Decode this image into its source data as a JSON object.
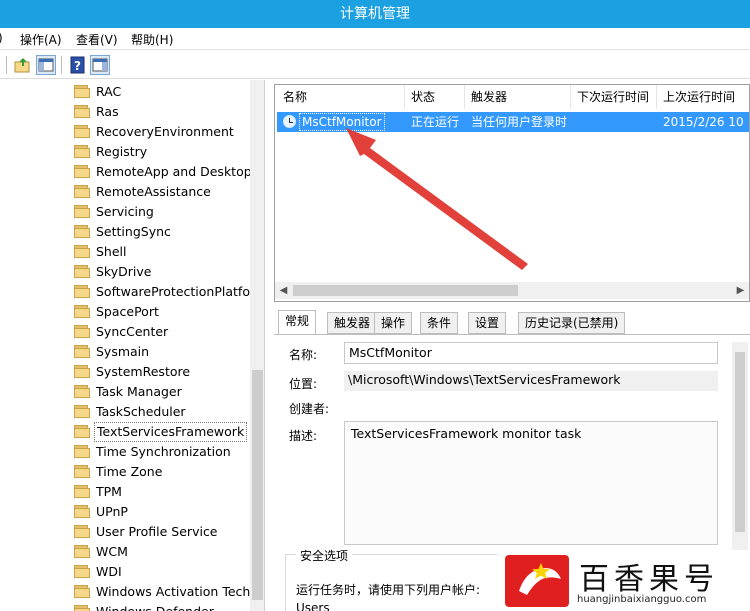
{
  "window": {
    "title": "计算机管理"
  },
  "menu": [
    {
      "label": ")"
    },
    {
      "label": "操作(A)"
    },
    {
      "label": "查看(V)"
    },
    {
      "label": "帮助(H)"
    }
  ],
  "toolbar": {
    "icons": [
      "up-folder-icon",
      "show-hide-tree-icon",
      "help-icon",
      "show-hide-action-pane-icon"
    ]
  },
  "tree": {
    "items": [
      "RAC",
      "Ras",
      "RecoveryEnvironment",
      "Registry",
      "RemoteApp and Desktop",
      "RemoteAssistance",
      "Servicing",
      "SettingSync",
      "Shell",
      "SkyDrive",
      "SoftwareProtectionPlatform",
      "SpacePort",
      "SyncCenter",
      "Sysmain",
      "SystemRestore",
      "Task Manager",
      "TaskScheduler",
      "TextServicesFramework",
      "Time Synchronization",
      "Time Zone",
      "TPM",
      "UPnP",
      "User Profile Service",
      "WCM",
      "WDI",
      "Windows Activation Technologies",
      "Windows Defender"
    ],
    "selected": "TextServicesFramework"
  },
  "task_list": {
    "columns": [
      "名称",
      "状态",
      "触发器",
      "下次运行时间",
      "上次运行时间"
    ],
    "rows": [
      {
        "name": "MsCtfMonitor",
        "status": "正在运行",
        "trigger": "当任何用户登录时",
        "next_run": "",
        "last_run": "2015/2/26 10"
      }
    ]
  },
  "tabs": [
    {
      "label": "常规",
      "active": true
    },
    {
      "label": "触发器"
    },
    {
      "label": "操作"
    },
    {
      "label": "条件"
    },
    {
      "label": "设置"
    },
    {
      "label": "历史记录(已禁用)"
    }
  ],
  "general": {
    "name_label": "名称:",
    "name_value": "MsCtfMonitor",
    "location_label": "位置:",
    "location_value": "\\Microsoft\\Windows\\TextServicesFramework",
    "author_label": "创建者:",
    "description_label": "描述:",
    "description_value": "TextServicesFramework monitor task",
    "security_title": "安全选项",
    "security_text": "运行任务时，请使用下列用户帐户:",
    "security_user": "Users"
  },
  "watermark": {
    "brand": "百香果号",
    "url": "huangjinbaixiangguo.com"
  },
  "colors": {
    "titlebar": "#1ba1e2",
    "selection": "#3399ff",
    "arrow": "#e0312a"
  }
}
